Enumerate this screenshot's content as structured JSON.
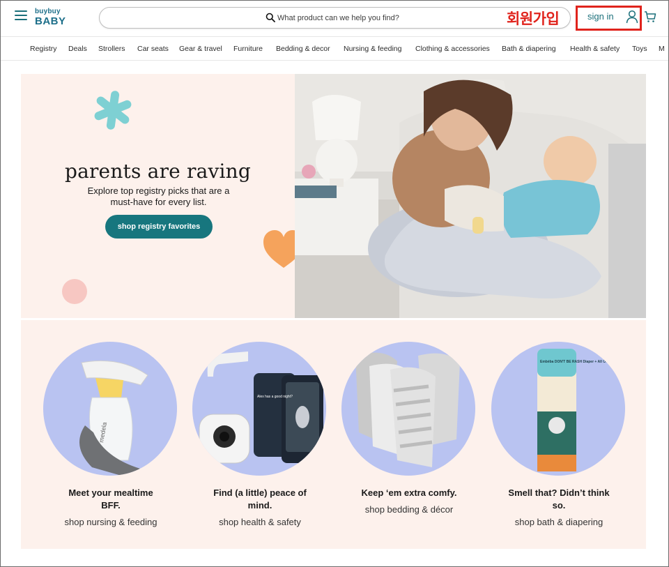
{
  "header": {
    "logo_top": "buybuy",
    "logo_bottom": "BABY",
    "search_placeholder": "What product can we help you find?",
    "korean_label": "회원가입",
    "signin_label": "sign in",
    "accent_color": "#17767e",
    "highlight_color": "#e0231c"
  },
  "nav": {
    "items": [
      "Registry",
      "Deals",
      "Strollers",
      "Car seats",
      "Gear & travel",
      "Furniture",
      "Bedding & decor",
      "Nursing & feeding",
      "Clothing & accessories",
      "Bath & diapering",
      "Health & safety",
      "Toys",
      "M"
    ]
  },
  "hero": {
    "title": "parents are raving",
    "subtitle_line1": "Explore top registry picks that are a",
    "subtitle_line2": "must-have for every list.",
    "cta": "shop registry favorites"
  },
  "categories": [
    {
      "title_line1": "Meet your mealtime",
      "title_line2": "BFF.",
      "link": "shop nursing & feeding",
      "product_text": "medela"
    },
    {
      "title_line1": "Find (a little) peace of",
      "title_line2": "mind.",
      "link": "shop health & safety",
      "product_text": "Alex has a good night?"
    },
    {
      "title_line1": "Keep ‘em extra comfy.",
      "title_line2": "",
      "link": "shop bedding & décor",
      "product_text": ""
    },
    {
      "title_line1": "Smell that? Didn’t think",
      "title_line2": "so.",
      "link": "shop bath & diapering",
      "product_text": "Embéba DON'T BE RASH Diaper + All Over Balm"
    }
  ]
}
